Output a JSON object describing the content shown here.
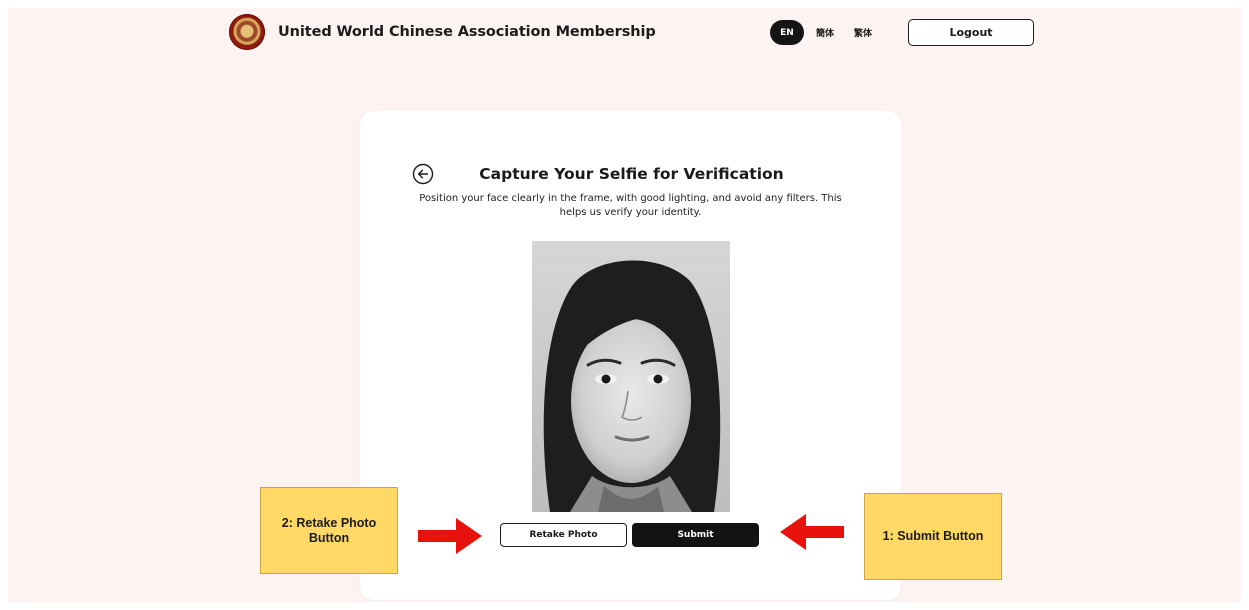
{
  "header": {
    "app_title": "United World Chinese Association Membership",
    "languages": [
      {
        "label": "EN",
        "active": true
      },
      {
        "label": "簡体",
        "active": false
      },
      {
        "label": "繁体",
        "active": false
      }
    ],
    "logout_label": "Logout"
  },
  "card": {
    "title": "Capture Your Selfie for Verification",
    "subtitle": "Position your face clearly in the frame, with good lighting, and avoid any filters. This helps us verify your identity.",
    "retake_label": "Retake Photo",
    "submit_label": "Submit"
  },
  "annotations": {
    "retake_note": "2: Retake Photo Button",
    "submit_note": "1: Submit Button",
    "arrow_color": "#e8120c"
  },
  "colors": {
    "background": "#fdf3f2",
    "primary_dark": "#111315",
    "note_yellow": "#ffd866"
  },
  "icons": {
    "back": "arrow-left-circle-icon",
    "logo": "association-emblem"
  }
}
